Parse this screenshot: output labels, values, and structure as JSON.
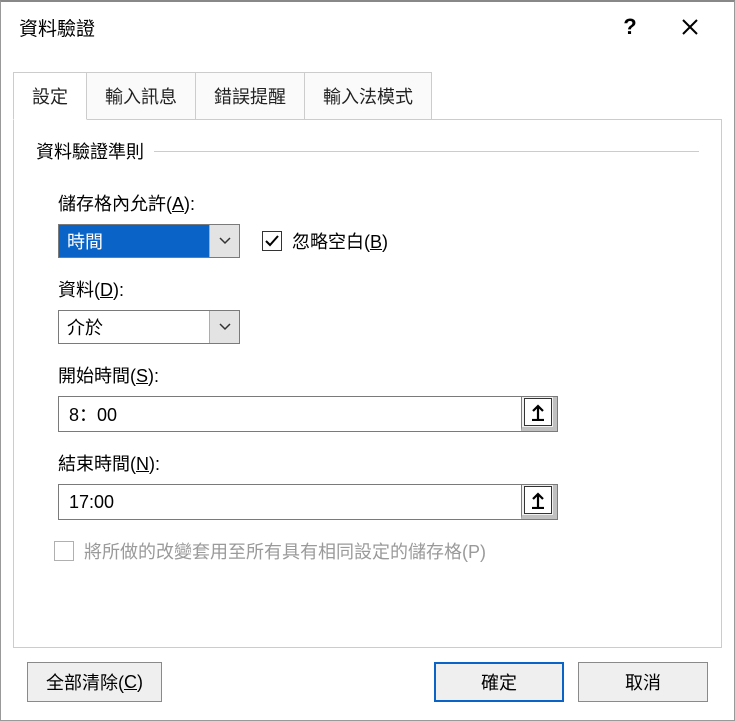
{
  "dialog": {
    "title": "資料驗證"
  },
  "tabs": {
    "settings": "設定",
    "input_message": "輸入訊息",
    "error_alert": "錯誤提醒",
    "ime_mode": "輸入法模式"
  },
  "group": {
    "criteria_label": "資料驗證準則"
  },
  "fields": {
    "allow_label_pre": "儲存格內允許(",
    "allow_key": "A",
    "allow_label_post": "):",
    "allow_value": "時間",
    "ignore_blank_label_pre": "忽略空白(",
    "ignore_blank_key": "B",
    "ignore_blank_label_post": ")",
    "ignore_blank_checked": true,
    "data_label_pre": "資料(",
    "data_key": "D",
    "data_label_post": "):",
    "data_value": "介於",
    "start_label_pre": "開始時間(",
    "start_key": "S",
    "start_label_post": "):",
    "start_value": "8：00",
    "end_label_pre": "結束時間(",
    "end_key": "N",
    "end_label_post": "):",
    "end_value": "17:00",
    "apply_all_label": "將所做的改變套用至所有具有相同設定的儲存格(P)",
    "apply_all_checked": false,
    "apply_all_enabled": false
  },
  "buttons": {
    "clear_all_pre": "全部清除(",
    "clear_all_key": "C",
    "clear_all_post": ")",
    "ok": "確定",
    "cancel": "取消"
  }
}
